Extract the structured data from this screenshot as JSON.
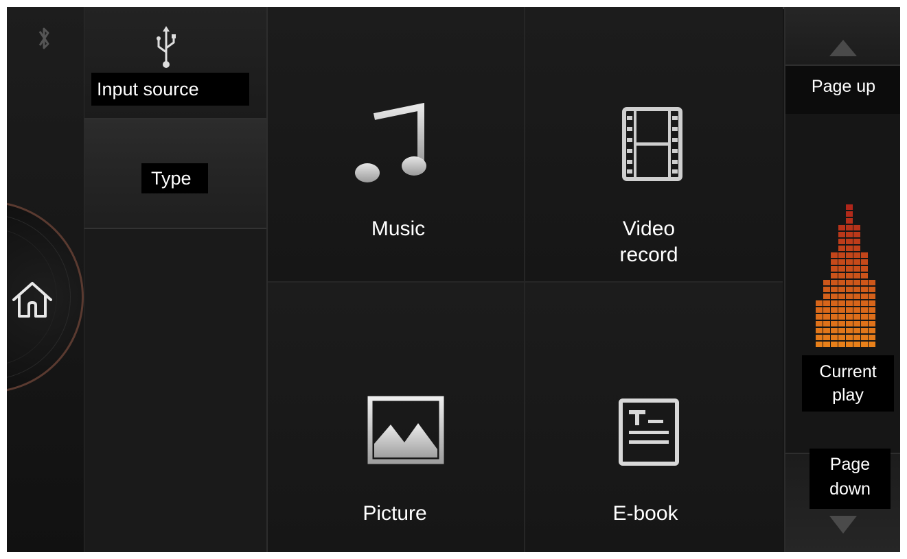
{
  "left_rail": {
    "bluetooth_icon": "bluetooth-icon",
    "home_icon": "home-icon"
  },
  "source": {
    "usb_icon": "usb-icon",
    "input_source_label": "Input source",
    "type_label": "Type"
  },
  "grid": {
    "items": [
      {
        "label": "Music",
        "icon": "music-note-icon"
      },
      {
        "label_line1": "Video",
        "label_line2": "record",
        "icon": "film-icon"
      },
      {
        "label": "Picture",
        "icon": "picture-icon"
      },
      {
        "label": "E-book",
        "icon": "ebook-icon"
      }
    ]
  },
  "right_rail": {
    "page_up_label": "Page up",
    "current_play_line1": "Current",
    "current_play_line2": "play",
    "page_down_line1": "Page",
    "page_down_line2": "down"
  },
  "colors": {
    "background": "#151515",
    "label_bg": "#000000",
    "text": "#ffffff",
    "equalizer_top": "#c0271a",
    "equalizer_bottom": "#e8801e"
  }
}
